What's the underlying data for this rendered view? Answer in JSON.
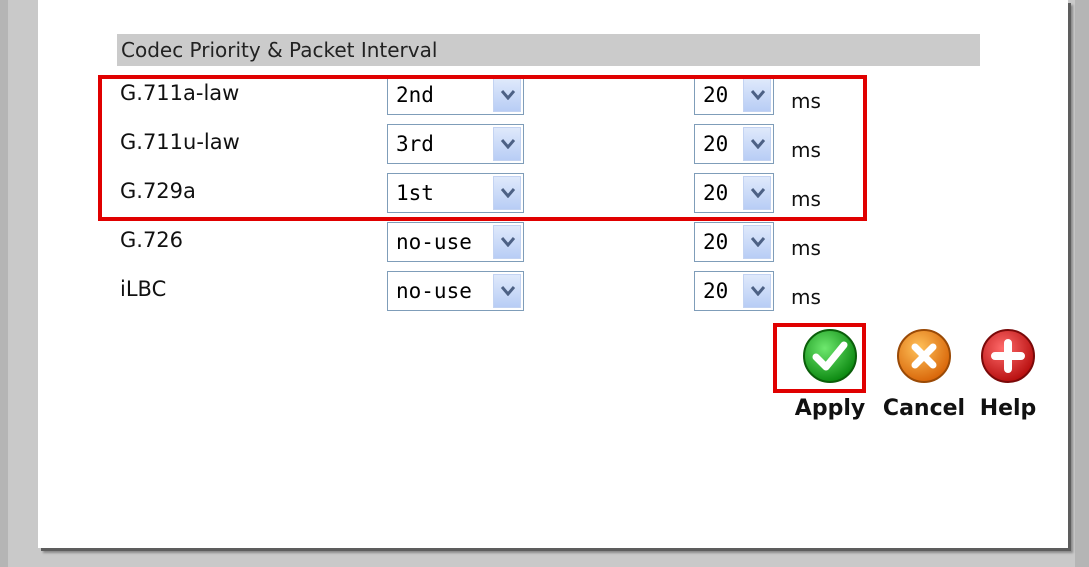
{
  "section": {
    "title": "Codec Priority & Packet Interval"
  },
  "codecs": [
    {
      "name": "G.711a-law",
      "priority": "2nd",
      "interval": "20",
      "unit": "ms"
    },
    {
      "name": "G.711u-law",
      "priority": "3rd",
      "interval": "20",
      "unit": "ms"
    },
    {
      "name": "G.729a",
      "priority": "1st",
      "interval": "20",
      "unit": "ms"
    },
    {
      "name": "G.726",
      "priority": "no-use",
      "interval": "20",
      "unit": "ms"
    },
    {
      "name": "iLBC",
      "priority": "no-use",
      "interval": "20",
      "unit": "ms"
    }
  ],
  "actions": {
    "apply_label": "Apply",
    "cancel_label": "Cancel",
    "help_label": "Help"
  },
  "icons": {
    "apply": "check-icon",
    "cancel": "x-icon",
    "help": "plus-icon"
  },
  "colors": {
    "highlight": "#e00000",
    "apply_green": "#1aa61a",
    "cancel_orange": "#f08a10",
    "help_red": "#d81e1e",
    "header_bg": "#cbcbcb"
  }
}
